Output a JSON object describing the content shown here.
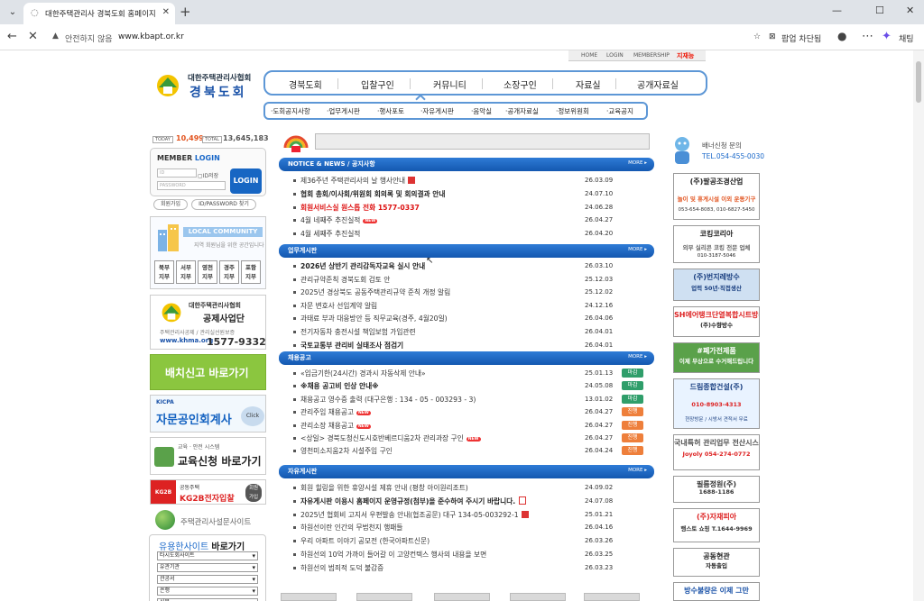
{
  "browser": {
    "tab_title": "대한주택관리사 경북도회 홈페이지",
    "new_tab": "+",
    "controls": {
      "minimize": "—",
      "maximize": "☐",
      "close": "✕"
    },
    "omnibox": {
      "security_label": "안전하지 않음",
      "url": "www.kbapt.or.kr"
    },
    "popup_blocked": "팝업 차단됨",
    "chat_label": "채팅",
    "icons": [
      "back-icon",
      "stop-icon",
      "warning-icon",
      "star-icon",
      "popup-blocked-icon",
      "profile-icon",
      "more-icon",
      "copilot-icon"
    ]
  },
  "site": {
    "top_links": [
      "HOME",
      "LOGIN",
      "MEMBERSHIP"
    ],
    "top_badge": "지재능",
    "logo_top": "대한주택관리사협회",
    "logo_main": "경북도회",
    "gnb": [
      "경북도회",
      "입찰구인",
      "커뮤니티",
      "소장구인",
      "자료실",
      "공개자료실"
    ],
    "subnav": [
      "·도회공지사항",
      "·업무게시판",
      "·행사포토",
      "·자유게시판",
      "·음악실",
      "·공개자료실",
      "·정보위원회",
      "·교육공지"
    ],
    "counter": {
      "today_label": "TODAY",
      "today": "10,499",
      "total_label": "TOTAL",
      "total": "13,645,183"
    },
    "login": {
      "title_a": "MEMBER",
      "title_b": "LOGIN",
      "id_placeholder": "ID",
      "pw_placeholder": "PASSWORD",
      "save_id": "ID저장",
      "button": "LOGIN",
      "join": "회원가입",
      "find": "ID/PASSWORD 찾기"
    },
    "local": {
      "title": "LOCAL COMMUNITY",
      "subtitle": "지역 회원님을 위한 공간입니다",
      "branches": [
        [
          "북부",
          "지부"
        ],
        [
          "서부",
          "지부"
        ],
        [
          "영천",
          "지부"
        ],
        [
          "경주",
          "지부"
        ],
        [
          "포항",
          "지부"
        ]
      ]
    },
    "gongje": {
      "t1": "대한주택관리사협회",
      "t2": "공제사업단",
      "t3": "주택관리사공제 / 관리실선원보증",
      "t4": "www.khma.org",
      "t5": "1577-9332"
    },
    "baechi": "배치신고 바로가기",
    "jaemun": {
      "org": "KICPA",
      "main": "자문공인회계사",
      "click": "Click"
    },
    "edu": {
      "sub": "교육 · 안전 시스템",
      "main": "교육신청 바로가기"
    },
    "kg2b": {
      "logo": "KG2B",
      "sub": "공동주택",
      "main": "KG2B전자입찰",
      "side_a": "회원",
      "side_b": "가입"
    },
    "survey": "주택관리사설문사이트",
    "useful_sites": {
      "title_a": "유용한사이트",
      "title_b": "바로가기",
      "selects": [
        "타시도회사이트",
        "유관기관",
        "관공서",
        "은행",
        "신문"
      ]
    },
    "notice": {
      "title": "NOTICE & NEWS / 공지사항",
      "more": "MORE ▸",
      "rows": [
        {
          "title": "제36주년 주택관리사의 날 행사안내",
          "date": "26.03.09",
          "style": "normal",
          "tag": "file"
        },
        {
          "title": "협회 총회/이사회/위원회 회의록 및 회의결과 안내",
          "date": "24.07.10",
          "style": "bold",
          "tag": ""
        },
        {
          "title": "회원서비스실 원스톱 전화 1577-0337",
          "date": "24.06.28",
          "style": "red",
          "tag": ""
        },
        {
          "title": "4월 네째주 추진실적",
          "date": "26.04.27",
          "style": "normal",
          "tag": "new"
        },
        {
          "title": "4월 세째주 추진실적",
          "date": "26.04.20",
          "style": "normal",
          "tag": ""
        }
      ]
    },
    "work": {
      "title": "업무게시판",
      "more": "MORE ▸",
      "rows": [
        {
          "title": "2026년 상반기 관리감독자교육 실시 안내",
          "date": "26.03.10",
          "style": "bold"
        },
        {
          "title": "관리규약준칙 경북도회 검토 안",
          "date": "25.12.03",
          "style": "normal"
        },
        {
          "title": "2025년 경상북도 공동주택관리규약 준칙 개정 알림",
          "date": "25.12.02",
          "style": "normal"
        },
        {
          "title": "자문 변호사 선임계약 알림",
          "date": "24.12.16",
          "style": "normal"
        },
        {
          "title": "과태료 부과 대응방안 등 직무교육(경주, 4월20일)",
          "date": "26.04.06",
          "style": "normal"
        },
        {
          "title": "전기자동차 충전시설 책임보험 가입관련",
          "date": "26.04.01",
          "style": "normal"
        },
        {
          "title": "국토교통부 관리비 실태조사 점검기",
          "date": "26.04.01",
          "style": "bold"
        }
      ]
    },
    "jobs": {
      "title": "채용공고",
      "more": "MORE ▸",
      "rows": [
        {
          "title": "«입금기한(24시간) 경과시 자동삭제 안내»",
          "date": "25.01.13",
          "badge": "마감",
          "badge_type": "end",
          "style": "normal",
          "tag": ""
        },
        {
          "title": "※채용 공고비 인상 안내※",
          "date": "24.05.08",
          "badge": "마감",
          "badge_type": "end",
          "style": "bold",
          "tag": ""
        },
        {
          "title": "채용공고 영수증 출력 (대구은행 : 134 - 05 - 003293 - 3)",
          "date": "13.01.02",
          "badge": "마감",
          "badge_type": "end",
          "style": "normal",
          "tag": ""
        },
        {
          "title": "관리주임 채용공고",
          "date": "26.04.27",
          "badge": "진행",
          "badge_type": "ing",
          "style": "normal",
          "tag": "new"
        },
        {
          "title": "관리소장 채용공고",
          "date": "26.04.27",
          "badge": "진행",
          "badge_type": "ing",
          "style": "normal",
          "tag": "new"
        },
        {
          "title": "<상일> 경북도청신도시호반베르디움2차 관리과장 구인",
          "date": "26.04.27",
          "badge": "진행",
          "badge_type": "ing",
          "style": "normal",
          "tag": "new"
        },
        {
          "title": "영천미소지움2차 시설주임 구인",
          "date": "26.04.24",
          "badge": "진행",
          "badge_type": "ing",
          "style": "normal",
          "tag": ""
        }
      ]
    },
    "free": {
      "title": "자유게시판",
      "more": "MORE ▸",
      "rows": [
        {
          "title": "회원 힐링을 위한 휴양시설 제휴 안내 (평창 아이원리조트)",
          "date": "24.09.02",
          "style": "normal",
          "tag": ""
        },
        {
          "title": "자유게시판 이용시 홈페이지 운영규정(첨부)을 준수하여 주시기 바랍니다.",
          "date": "24.07.08",
          "style": "bold",
          "tag": "pdf"
        },
        {
          "title": "2025년 협회비 고지서 우편발송 안내(협조공문) 대구 134-05-003292-1",
          "date": "25.01.21",
          "style": "normal",
          "tag": "file"
        },
        {
          "title": "하원선이란 인간의 무법천지 행패들",
          "date": "26.04.16",
          "style": "normal",
          "tag": ""
        },
        {
          "title": "우리 아파트 이야기 공모전 (한국아파트신문)",
          "date": "26.03.26",
          "style": "normal",
          "tag": ""
        },
        {
          "title": "하원선의 10억 가까이 들어갈 이 고양컨텍스 행사의 내용을 보면",
          "date": "26.03.25",
          "style": "normal",
          "tag": ""
        },
        {
          "title": "하원선의 범죄적 도덕 불감증",
          "date": "26.03.23",
          "style": "normal",
          "tag": ""
        }
      ]
    },
    "tag_new": "NEW",
    "right": {
      "inq_t1": "배너신청 문의",
      "inq_t2": "TEL.054-455-0030",
      "ads": [
        {
          "l1": "(주)팔공조경산업",
          "l2": "놀이 및 휴게시설 이외 운동기구",
          "l3": "053-654-8083, 010-6827-5450"
        },
        {
          "l1": "코킹코리아",
          "l2": "외부 실리콘 코킹 전문 업체",
          "l3": "010-3187-5046"
        },
        {
          "l1": "(주)번지레방수",
          "l2": "업력 50년·직접생산"
        },
        {
          "l1": "SH에어탱크단열복합시트방수",
          "l2": "(주)수향방수"
        },
        {
          "l1": "#폐가전제품",
          "l2": "이제 무상으로 수거해드립니다"
        },
        {
          "l1": "드림종합건설(주)",
          "l2": "010-8903-4313",
          "l3": "현장방문 / 시방서 견적서 무료"
        },
        {
          "l1": "국내특허 관리업무 전산시스템",
          "l2": "Joyoly 054-274-0772"
        },
        {
          "l1": "필름정원(주)",
          "l2": "1688-1186"
        },
        {
          "l1": "(주)자재피아",
          "l2": "행스토 쇼핑 T.1644-9969"
        },
        {
          "l1": "공동현관",
          "l2": "자동출입"
        },
        {
          "l1": "방수불량은 이제 그만"
        }
      ]
    }
  }
}
